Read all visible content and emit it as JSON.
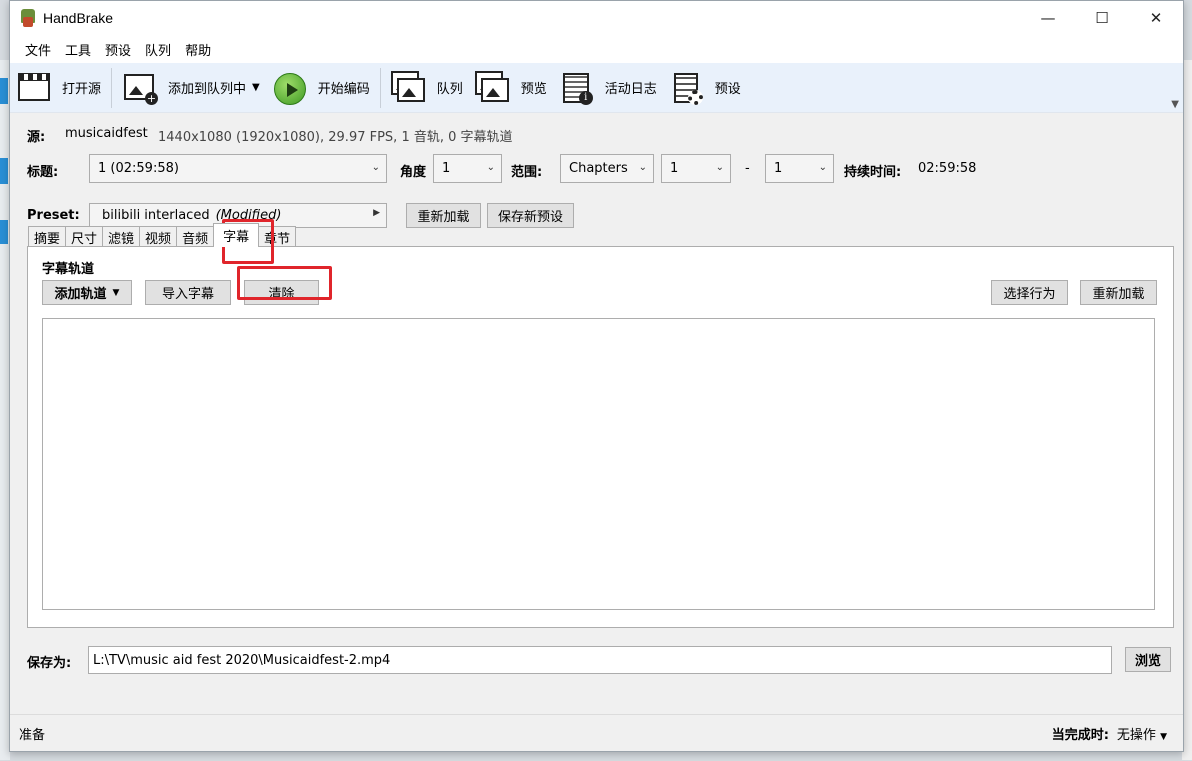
{
  "window": {
    "title": "HandBrake"
  },
  "menu": [
    "文件",
    "工具",
    "预设",
    "队列",
    "帮助"
  ],
  "toolbar": {
    "open_source": "打开源",
    "add_to_queue": "添加到队列中",
    "start_encode": "开始编码",
    "queue": "队列",
    "preview": "预览",
    "activity_log": "活动日志",
    "presets": "预设"
  },
  "source": {
    "label": "源:",
    "name": "musicaidfest",
    "info": "1440x1080 (1920x1080), 29.97 FPS, 1 音轨, 0 字幕轨道"
  },
  "title_row": {
    "title_label": "标题:",
    "title_value": "1  (02:59:58)",
    "angle_label": "角度",
    "angle_value": "1",
    "range_label": "范围:",
    "range_type": "Chapters",
    "range_start": "1",
    "range_dash": "-",
    "range_end": "1",
    "duration_label": "持续时间:",
    "duration_value": "02:59:58"
  },
  "preset": {
    "label": "Preset:",
    "name": "bilibili interlaced",
    "modified": "(Modified)",
    "reload": "重新加载",
    "save_new": "保存新预设"
  },
  "tabs": [
    "摘要",
    "尺寸",
    "滤镜",
    "视频",
    "音频",
    "字幕",
    "章节"
  ],
  "active_tab": "字幕",
  "subtitles": {
    "section_title": "字幕轨道",
    "add_track": "添加轨道",
    "import": "导入字幕",
    "clear": "清除",
    "choose_behavior": "选择行为",
    "reload": "重新加载"
  },
  "save": {
    "label": "保存为:",
    "path": "L:\\TV\\music aid fest 2020\\Musicaidfest-2.mp4",
    "browse": "浏览"
  },
  "status": {
    "text": "准备",
    "when_done_label": "当完成时:",
    "when_done_value": "无操作"
  },
  "colors": {
    "highlight": "#e0252b",
    "toolbar_bg": "#e9f1fb"
  }
}
